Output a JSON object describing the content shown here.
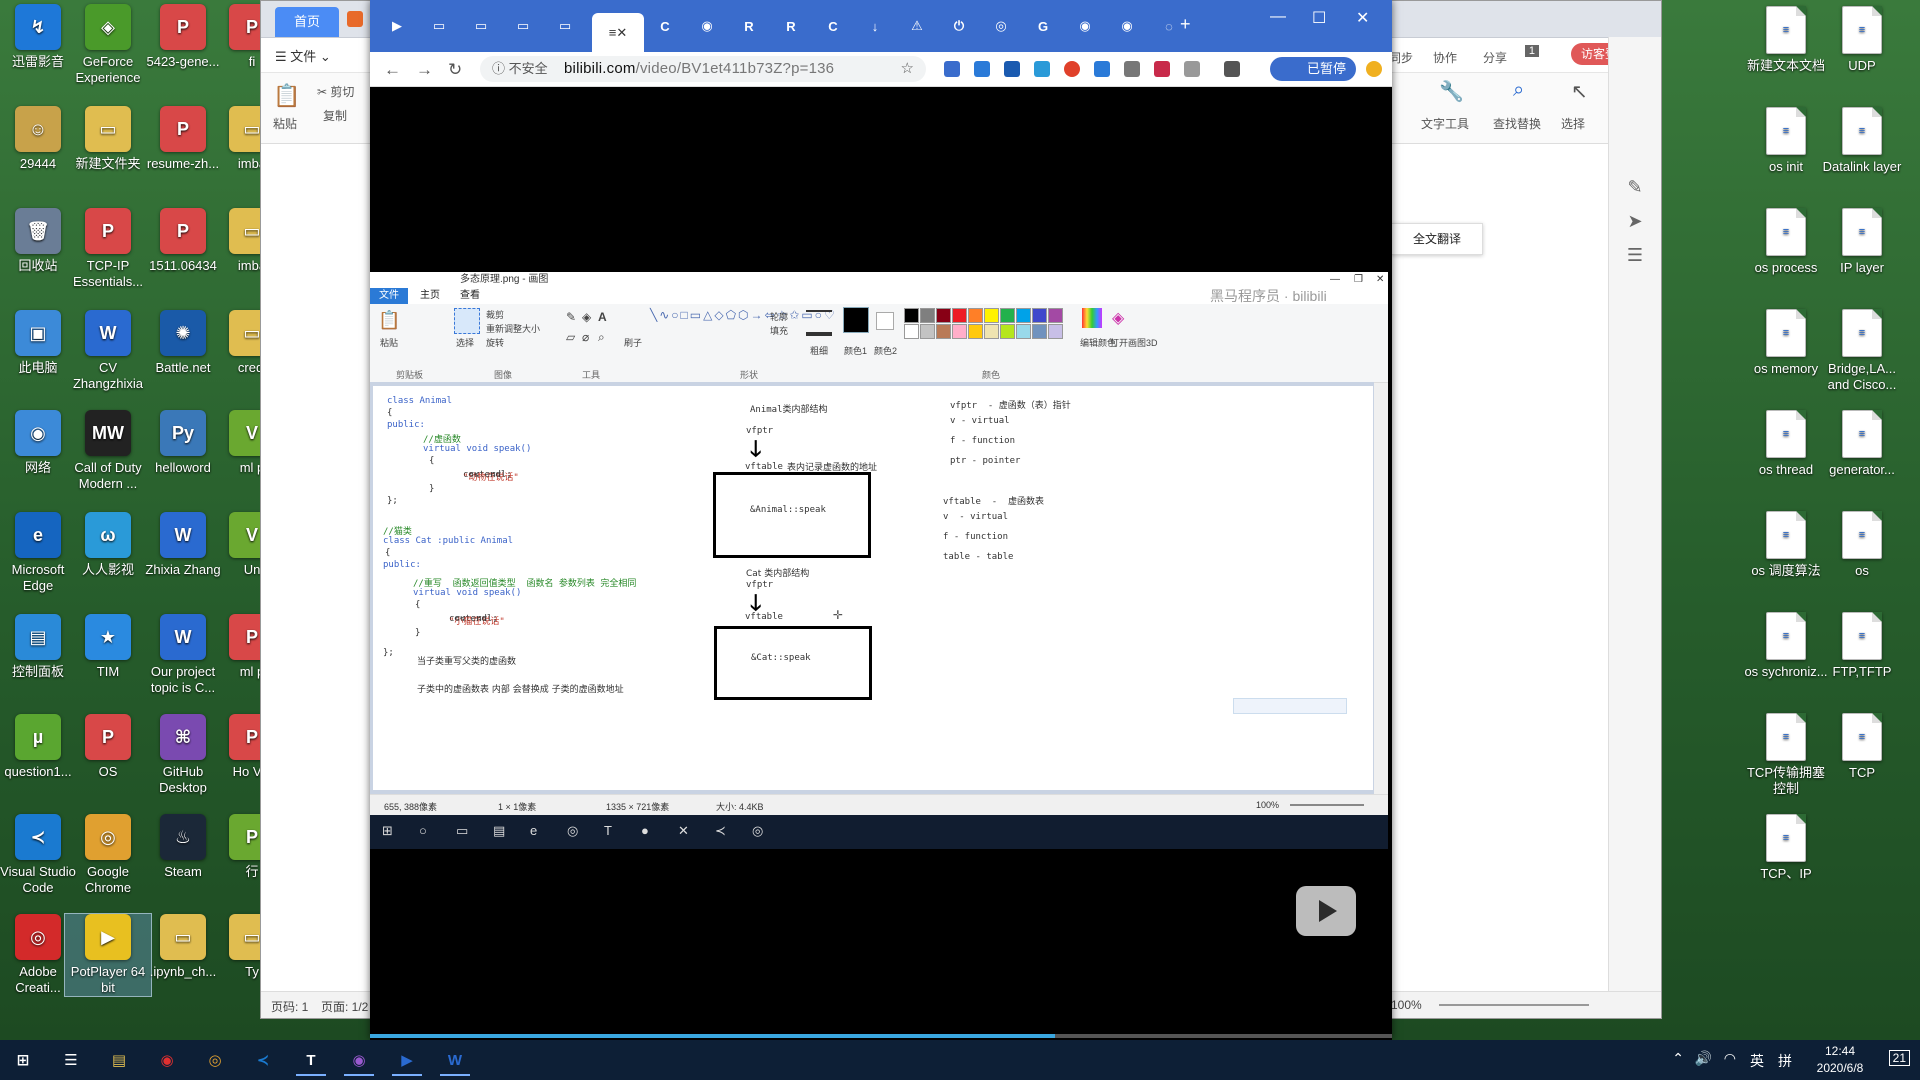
{
  "desktop_icons": [
    {
      "label": "迅雷影音",
      "color": "#1e78d8",
      "glyph": "↯"
    },
    {
      "label": "29444",
      "color": "#c8a24a",
      "glyph": "☺"
    },
    {
      "label": "回收站",
      "color": "#6a7d96",
      "glyph": "🗑"
    },
    {
      "label": "此电脑",
      "color": "#3c8ad8",
      "glyph": "▣"
    },
    {
      "label": "网络",
      "color": "#3c8ad8",
      "glyph": "◉"
    },
    {
      "label": "Microsoft Edge",
      "color": "#1565c0",
      "glyph": "e"
    },
    {
      "label": "控制面板",
      "color": "#2a8ad8",
      "glyph": "▤"
    },
    {
      "label": "question1...",
      "color": "#5aa630",
      "glyph": "µ"
    },
    {
      "label": "Visual Studio Code",
      "color": "#1a7ad0",
      "glyph": "≺"
    },
    {
      "label": "Adobe Creati...",
      "color": "#d32a2a",
      "glyph": "◎"
    },
    {
      "label": "GeForce Experience",
      "color": "#4a9a2a",
      "glyph": "◈"
    },
    {
      "label": "新建文件夹",
      "color": "#e0bd50",
      "glyph": "▭"
    },
    {
      "label": "TCP-IP Essentials...",
      "color": "#d84848",
      "glyph": "P"
    },
    {
      "label": "CV Zhangzhixia",
      "color": "#2a6ad0",
      "glyph": "W"
    },
    {
      "label": "Call of Duty Modern ...",
      "color": "#222222",
      "glyph": "MW"
    },
    {
      "label": "人人影视",
      "color": "#2a9ad8",
      "glyph": "ω"
    },
    {
      "label": "TIM",
      "color": "#2a8ae0",
      "glyph": "★"
    },
    {
      "label": "OS",
      "color": "#d84848",
      "glyph": "P"
    },
    {
      "label": "Google Chrome",
      "color": "#e0a030",
      "glyph": "◎"
    },
    {
      "label": "PotPlayer 64 bit",
      "color": "#e8c020",
      "glyph": "▶"
    },
    {
      "label": "5423-gene...",
      "color": "#d84848",
      "glyph": "P"
    },
    {
      "label": "resume-zh...",
      "color": "#d84848",
      "glyph": "P"
    },
    {
      "label": "1511.06434",
      "color": "#d84848",
      "glyph": "P"
    },
    {
      "label": "Battle.net",
      "color": "#1a5aa8",
      "glyph": "✺"
    },
    {
      "label": "helloword",
      "color": "#3a78b8",
      "glyph": "Py"
    },
    {
      "label": "Zhixia Zhang",
      "color": "#2a6ad0",
      "glyph": "W"
    },
    {
      "label": "Our project topic is C...",
      "color": "#2a6ad0",
      "glyph": "W"
    },
    {
      "label": "GitHub Desktop",
      "color": "#7a4ab0",
      "glyph": "⌘"
    },
    {
      "label": "Steam",
      "color": "#1b2838",
      "glyph": "♨"
    },
    {
      "label": ".ipynb_ch...",
      "color": "#e0bd50",
      "glyph": "▭"
    },
    {
      "label": "fi",
      "color": "#d84848",
      "glyph": "P"
    },
    {
      "label": "imba",
      "color": "#e0bd50",
      "glyph": "▭"
    },
    {
      "label": "imba",
      "color": "#e0bd50",
      "glyph": "▭"
    },
    {
      "label": "credi",
      "color": "#e0bd50",
      "glyph": "▭"
    },
    {
      "label": "ml p",
      "color": "#6aa830",
      "glyph": "V"
    },
    {
      "label": "Un",
      "color": "#6aa830",
      "glyph": "V"
    },
    {
      "label": "ml p",
      "color": "#d84848",
      "glyph": "P"
    },
    {
      "label": "Ho Vie",
      "color": "#d84848",
      "glyph": "P"
    },
    {
      "label": "行",
      "color": "#6aa830",
      "glyph": "P"
    },
    {
      "label": "Ty",
      "color": "#e0bd50",
      "glyph": "▭"
    }
  ],
  "right_icons": [
    {
      "label": "新建文本文档"
    },
    {
      "label": "UDP"
    },
    {
      "label": "os init"
    },
    {
      "label": "Datalink layer"
    },
    {
      "label": "os process"
    },
    {
      "label": "IP layer"
    },
    {
      "label": "os memory"
    },
    {
      "label": "Bridge,LA... and Cisco..."
    },
    {
      "label": "os thread"
    },
    {
      "label": "generator..."
    },
    {
      "label": "os 调度算法"
    },
    {
      "label": "os"
    },
    {
      "label": "os sychroniz..."
    },
    {
      "label": "FTP,TFTP"
    },
    {
      "label": "TCP传输拥塞控制"
    },
    {
      "label": "TCP"
    },
    {
      "label": "TCP、IP"
    }
  ],
  "wps": {
    "home_tab": "首页",
    "menu_file": "☰ 文件 ⌄",
    "paste": "粘贴",
    "cut": "✂ 剪切",
    "copy": "复制",
    "sync": "同步",
    "collab": "协作",
    "share": "分享",
    "login": "访客登录",
    "text_tools": "文字工具",
    "find_replace": "查找替换",
    "select": "选择",
    "full_translate": "全文翻译",
    "page_num": "页码: 1",
    "page_of": "页面: 1/2",
    "zoom": "100%",
    "badge": "1"
  },
  "chrome": {
    "url_security": "不安全",
    "url_host": "bilibili.com",
    "url_path": "/video/BV1et411b73Z?p=136",
    "paused": "已暂停",
    "tabs": [
      "▶",
      "▭",
      "▭",
      "▭",
      "▭",
      "≡",
      "C",
      "◉",
      "R",
      "R",
      "C",
      "↓",
      "⚠",
      "⏻",
      "◎",
      "G",
      "◉",
      "◉",
      "◌"
    ],
    "active_tab_index": 5,
    "progress": 0.67
  },
  "paint": {
    "title": "多态原理.png - 画图",
    "menu": [
      "文件",
      "主页",
      "查看"
    ],
    "groups": [
      "剪贴板",
      "图像",
      "工具",
      "形状",
      "颜色"
    ],
    "labels": {
      "paste": "粘贴",
      "select": "选择",
      "crop": "裁剪",
      "resize": "重新调整大小",
      "rotate": "旋转",
      "brush": "刷子",
      "outline": "轮廓",
      "fill": "填充",
      "thickness": "粗细",
      "color1": "颜色1",
      "color2": "颜色2",
      "edit_colors": "编辑颜色",
      "paint3d": "打开画图3D"
    },
    "watermark": "黑马程序员 · bilibili",
    "status": {
      "coords": "655, 388像素",
      "sel": "1 × 1像素",
      "size": "1335 × 721像素",
      "file": "大小: 4.4KB",
      "zoom": "100%"
    },
    "palette": [
      "#000000",
      "#7f7f7f",
      "#880015",
      "#ed1c24",
      "#ff7f27",
      "#fff200",
      "#22b14c",
      "#00a2e8",
      "#3f48cc",
      "#a349a4",
      "#ffffff",
      "#c3c3c3",
      "#b97a57",
      "#ffaec9",
      "#ffc90e",
      "#efe4b0",
      "#b5e61d",
      "#99d9ea",
      "#7092be",
      "#c8bfe7"
    ]
  },
  "code": {
    "line1": "class Animal",
    "line2": "{",
    "line3": "public:",
    "line4": "//虚函数",
    "line5": "virtual void speak()",
    "line6": "{",
    "line7a": "cout << ",
    "line7b": "\"动物在说话\"",
    "line7c": " << endl;",
    "line8": "}",
    "line9": "};",
    "cat1": "//猫类",
    "cat2": "class Cat :public Animal",
    "cat3": "{",
    "cat4": "public:",
    "cat5": "//重写  函数返回值类型  函数名 参数列表 完全相同",
    "cat6": "virtual void speak()",
    "cat7": "{",
    "cat8a": "cout << ",
    "cat8b": "\"小猫在说话\"",
    "cat8c": " << endl;",
    "cat9": "}",
    "cat10": "};",
    "note1": "当子类重写父类的虚函数",
    "note2": "子类中的虚函数表 内部 会替换成 子类的虚函数地址"
  },
  "diagram": {
    "title1": "Animal类内部结构",
    "vfptr": "vfptr",
    "vftable": "vftable",
    "vftable_note": "表内记录虚函数的地址",
    "box1": "&Animal::speak",
    "title2": "Cat 类内部结构",
    "box2": "&Cat::speak"
  },
  "legend": {
    "a1": "vfptr  - 虚函数（表）指针",
    "a2": "v - virtual",
    "a3": "f - function",
    "a4": "ptr - pointer",
    "b1": "vftable  -  虚函数表",
    "b2": "v  - virtual",
    "b3": "f - function",
    "b4": "table - table"
  },
  "inner_taskbar": [
    "⊞",
    "○",
    "▭",
    "▤",
    "e",
    "◎",
    "T",
    "●",
    "✕",
    "≺",
    "◎"
  ],
  "taskbar": {
    "time": "12:44",
    "date": "2020/6/8",
    "ime": "英",
    "lang": "拼",
    "notify": "21",
    "apps": [
      "⊞",
      "☰",
      "▤",
      "◉",
      "◎",
      "≺",
      "T",
      "◉",
      "▶",
      "W"
    ]
  }
}
